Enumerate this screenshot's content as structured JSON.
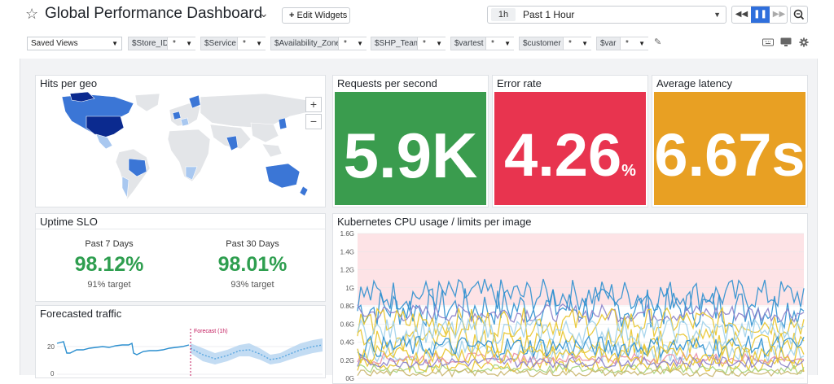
{
  "header": {
    "title": "Global Performance Dashboard",
    "edit_widgets_label": "Edit Widgets"
  },
  "timeframe": {
    "tag": "1h",
    "label": "Past 1 Hour"
  },
  "filters": {
    "saved_views_label": "Saved Views",
    "variables": [
      {
        "name": "$Store_ID",
        "value": "*"
      },
      {
        "name": "$Service",
        "value": "*"
      },
      {
        "name": "$Availability_Zone",
        "value": "*"
      },
      {
        "name": "$SHP_Team",
        "value": "*"
      },
      {
        "name": "$vartest",
        "value": "*"
      },
      {
        "name": "$customer",
        "value": "*"
      },
      {
        "name": "$var",
        "value": "*"
      }
    ]
  },
  "widgets": {
    "hits_per_geo": {
      "title": "Hits per geo",
      "zoom_in": "+",
      "zoom_out": "−"
    },
    "requests_per_second": {
      "title": "Requests per second",
      "value": "5.9K",
      "unit": "",
      "color": "#3a9c4e"
    },
    "error_rate": {
      "title": "Error rate",
      "value": "4.26",
      "unit": "%",
      "color": "#e8344f"
    },
    "average_latency": {
      "title": "Average latency",
      "value": "6.67s",
      "unit": "",
      "color": "#e8a023"
    },
    "uptime_slo": {
      "title": "Uptime SLO",
      "periods": [
        {
          "label": "Past 7 Days",
          "value": "98.12%",
          "target": "91% target"
        },
        {
          "label": "Past 30 Days",
          "value": "98.01%",
          "target": "93% target"
        }
      ]
    },
    "forecasted_traffic": {
      "title": "Forecasted traffic",
      "forecast_label": "Forecast (1h)",
      "y_ticks": [
        "20",
        "0"
      ]
    },
    "k8s_cpu": {
      "title": "Kubernetes CPU usage / limits per image",
      "y_ticks": [
        "1.6G",
        "1.4G",
        "1.2G",
        "1G",
        "0.8G",
        "0.6G",
        "0.4G",
        "0.2G",
        "0G"
      ]
    }
  },
  "colors": {
    "accent": "#2f6fdc",
    "map_dark": "#0b2a8f",
    "map_mid": "#3b76d6",
    "map_light": "#a9c8f0"
  }
}
